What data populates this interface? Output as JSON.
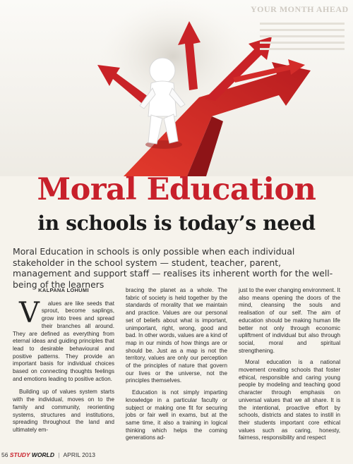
{
  "ghost_header": "YOUR MONTH AHEAD",
  "title": "Moral Education",
  "subtitle": "in schools is today’s need",
  "standfirst": "Moral Education in schools is only possible when each individual stakeholder in the school system — student, teacher, parent, management and support staff — realises its inherent worth for the well-being of the learners",
  "byline": "KALPANA LOHUMI",
  "dropcap": "V",
  "col1": [
    "alues are like seeds that sprout, become saplings, grow into trees and spread their branches all around. They are defined as everything from eternal ideas and guiding principles that lead to desirable behavioural and positive patterns. They provide an important basis for individual choices based on connecting thoughts feelings and emotions leading to positive action.",
    "Building up of values system starts with the individual, moves on to the family and community, reorienting systems, structures and institutions, spreading throughout the land and ultimately em-"
  ],
  "col2": [
    "bracing the planet as a whole. The fabric of society is held together by the standards of morality that we maintain and practice. Values are our personal set of beliefs about what is important, unimportant, right, wrong, good and bad. In other words, values are a kind of map in our minds of how things are or should be. Just as a map is not the territory, values are only our perception of the principles of nature that govern our lives or the universe, not the principles themselves.",
    "Education is not simply imparting knowledge in a particular faculty or subject or making one fit for securing jobs or fair well in exams, but at the same time, it also a training in logical thinking which helps the coming generations ad-"
  ],
  "col3": [
    "just to the ever changing environment. It also means opening the doors of the mind, cleansing the souls and realisation of our self. The aim of education should be making human life better not only through economic upliftment of individual but also through social, moral and spiritual strengthening.",
    "Moral education is a national movement creating schools that foster ethical, responsible and caring young people by modeling and teaching good character through emphasis on universal values that we all share. It is the intentional, proactive effort by schools, districts and states to instill in their students important core ethical values such as caring, honesty, fairness, responsibility and respect"
  ],
  "footer": {
    "page_number": "56",
    "magazine_a": "STUDY",
    "magazine_b": "WORLD",
    "issue": "APRIL 2013"
  },
  "colors": {
    "accent": "#c8202b",
    "text": "#222222"
  }
}
